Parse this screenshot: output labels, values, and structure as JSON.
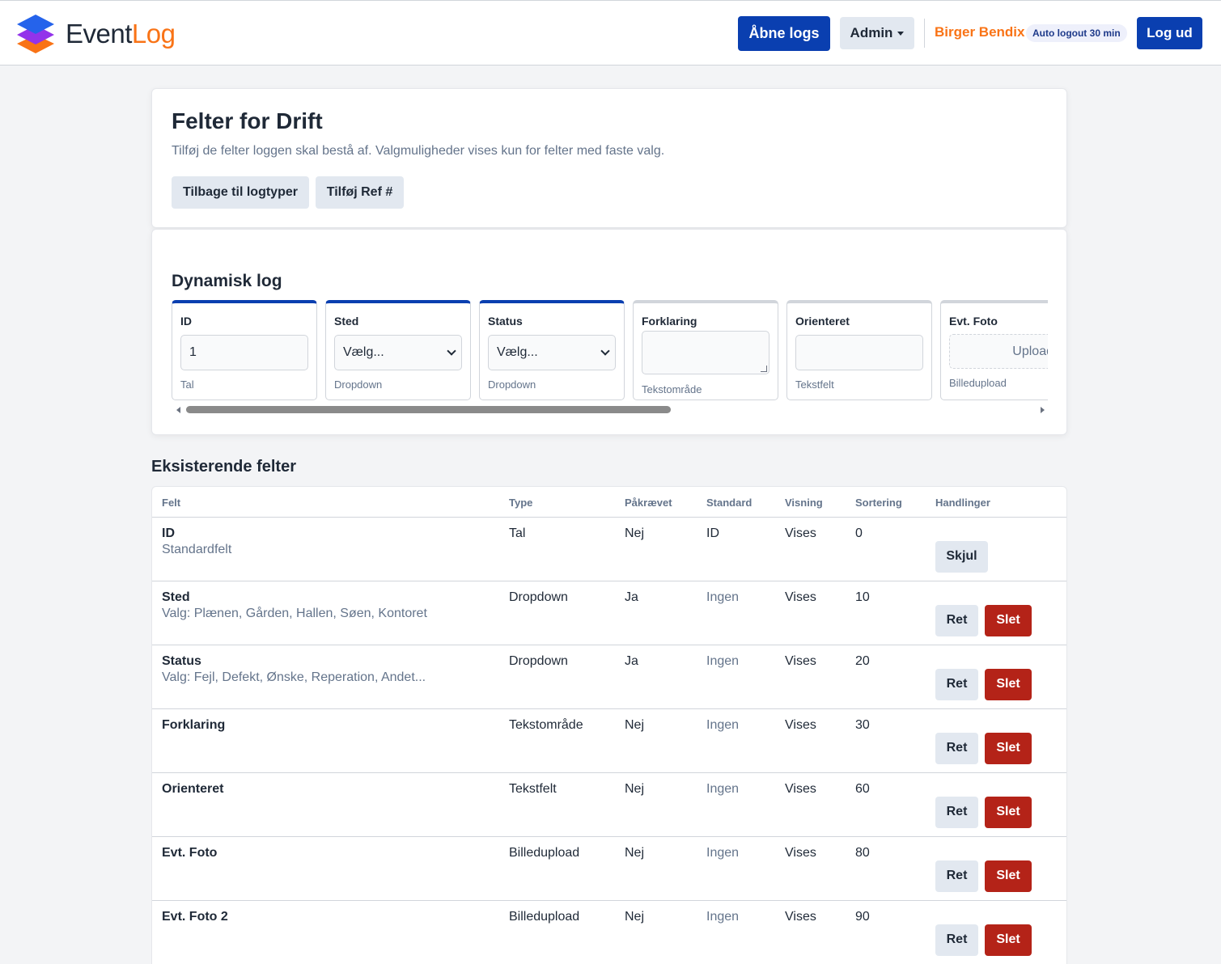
{
  "header": {
    "logo_text_a": "Event",
    "logo_text_b": "Log",
    "open_logs": "Åbne logs",
    "admin": "Admin",
    "user": "Birger Bendix",
    "auto_logout": "Auto logout 30 min",
    "logout": "Log ud"
  },
  "page": {
    "title": "Felter for Drift",
    "subtitle": "Tilføj de felter loggen skal bestå af. Valgmuligheder vises kun for felter med faste valg.",
    "back_button": "Tilbage til logtyper",
    "add_ref_button": "Tilføj Ref #"
  },
  "preview": {
    "title": "Dynamisk log",
    "fields": [
      {
        "label": "ID",
        "value": "1",
        "type": "Tal"
      },
      {
        "label": "Sted",
        "value": "Vælg...",
        "type": "Dropdown"
      },
      {
        "label": "Status",
        "value": "Vælg...",
        "type": "Dropdown"
      },
      {
        "label": "Forklaring",
        "value": "",
        "type": "Tekstområde"
      },
      {
        "label": "Orienteret",
        "value": "",
        "type": "Tekstfelt"
      },
      {
        "label": "Evt. Foto",
        "value": "Upload",
        "type": "Billedupload"
      }
    ]
  },
  "existing": {
    "title": "Eksisterende felter",
    "columns": [
      "Felt",
      "Type",
      "Påkrævet",
      "Standard",
      "Visning",
      "Sortering",
      "Handlinger"
    ],
    "rows": [
      {
        "name": "ID",
        "sub": "Standardfelt",
        "type": "Tal",
        "required": "Nej",
        "default": "ID",
        "display": "Vises",
        "sort": "0",
        "action_1": "Skjul"
      },
      {
        "name": "Sted",
        "sub": "Valg: Plænen, Gården, Hallen, Søen, Kontoret",
        "type": "Dropdown",
        "required": "Ja",
        "default": "Ingen",
        "display": "Vises",
        "sort": "10",
        "action_1": "Ret",
        "action_2": "Slet"
      },
      {
        "name": "Status",
        "sub": "Valg: Fejl, Defekt, Ønske, Reperation, Andet...",
        "type": "Dropdown",
        "required": "Ja",
        "default": "Ingen",
        "display": "Vises",
        "sort": "20",
        "action_1": "Ret",
        "action_2": "Slet"
      },
      {
        "name": "Forklaring",
        "sub": "",
        "type": "Tekstområde",
        "required": "Nej",
        "default": "Ingen",
        "display": "Vises",
        "sort": "30",
        "action_1": "Ret",
        "action_2": "Slet"
      },
      {
        "name": "Orienteret",
        "sub": "",
        "type": "Tekstfelt",
        "required": "Nej",
        "default": "Ingen",
        "display": "Vises",
        "sort": "60",
        "action_1": "Ret",
        "action_2": "Slet"
      },
      {
        "name": "Evt. Foto",
        "sub": "",
        "type": "Billedupload",
        "required": "Nej",
        "default": "Ingen",
        "display": "Vises",
        "sort": "80",
        "action_1": "Ret",
        "action_2": "Slet"
      },
      {
        "name": "Evt. Foto 2",
        "sub": "",
        "type": "Billedupload",
        "required": "Nej",
        "default": "Ingen",
        "display": "Vises",
        "sort": "90",
        "action_1": "Ret",
        "action_2": "Slet"
      }
    ]
  },
  "colors": {
    "primary": "#0a3fb0",
    "accent": "#f97316",
    "danger": "#b42318",
    "light_button": "#e2e8f0"
  }
}
